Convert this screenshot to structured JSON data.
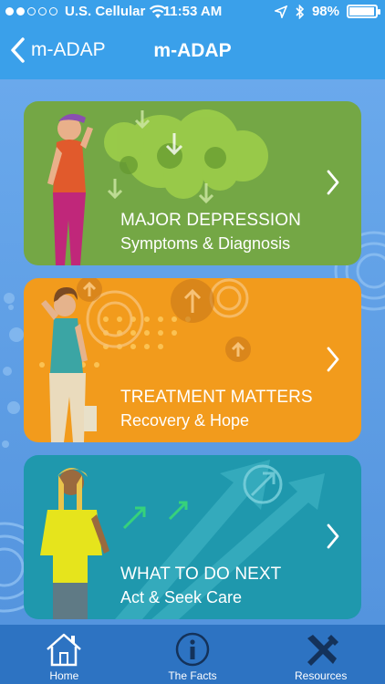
{
  "status_bar": {
    "carrier": "U.S. Cellular",
    "time": "11:53 AM",
    "battery": "98%",
    "signal_bars_filled": 2,
    "signal_bars_total": 5
  },
  "nav": {
    "back_label": "m-ADAP",
    "title": "m-ADAP"
  },
  "cards": [
    {
      "title": "MAJOR DEPRESSION",
      "subtitle": "Symptoms & Diagnosis",
      "color": "#74a745"
    },
    {
      "title": "TREATMENT MATTERS",
      "subtitle": "Recovery & Hope",
      "color": "#f29b1c"
    },
    {
      "title": "WHAT TO DO NEXT",
      "subtitle": "Act & Seek Care",
      "color": "#1f98ad"
    }
  ],
  "tabbar": {
    "items": [
      {
        "label": "Home",
        "icon": "home-icon"
      },
      {
        "label": "The Facts",
        "icon": "info-icon"
      },
      {
        "label": "Resources",
        "icon": "tools-icon"
      }
    ]
  },
  "colors": {
    "header": "#3aa0ea",
    "tabbar": "#2d73c2",
    "background": "#5a9ee6"
  }
}
